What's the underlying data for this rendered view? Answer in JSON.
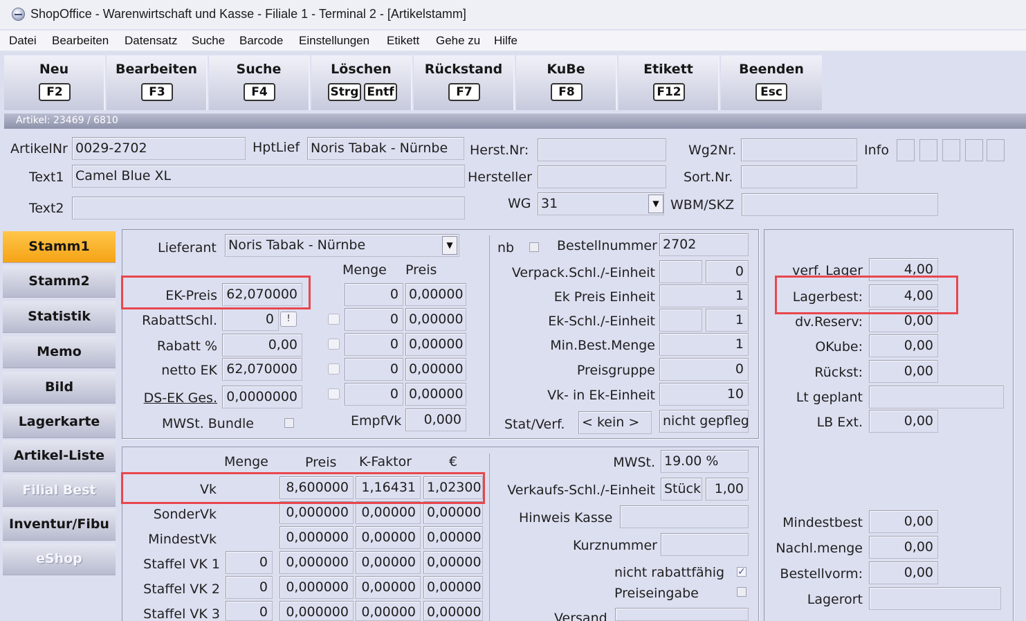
{
  "window": {
    "title": "ShopOffice - Warenwirtschaft und Kasse - Filiale 1 - Terminal 2 - [Artikelstamm]"
  },
  "menu": [
    "Datei",
    "Bearbeiten",
    "Datensatz",
    "Suche",
    "Barcode",
    "Einstellungen",
    "Etikett",
    "Gehe zu",
    "Hilfe"
  ],
  "toolbar": [
    {
      "label": "Neu",
      "keys": [
        "F2"
      ]
    },
    {
      "label": "Bearbeiten",
      "keys": [
        "F3"
      ]
    },
    {
      "label": "Suche",
      "keys": [
        "F4"
      ]
    },
    {
      "label": "Löschen",
      "keys": [
        "Strg",
        "Entf"
      ]
    },
    {
      "label": "Rückstand",
      "keys": [
        "F7"
      ]
    },
    {
      "label": "KuBe",
      "keys": [
        "F8"
      ]
    },
    {
      "label": "Etikett",
      "keys": [
        "F12"
      ]
    },
    {
      "label": "Beenden",
      "keys": [
        "Esc"
      ]
    }
  ],
  "infobar": "Artikel: 23469 / 6810",
  "header": {
    "artikelnr_label": "ArtikelNr",
    "artikelnr": "0029-2702",
    "hptlief_label": "HptLief",
    "hptlief": "Noris Tabak - Nürnbe",
    "herstnr_label": "Herst.Nr:",
    "herstnr": "",
    "wg2nr_label": "Wg2Nr.",
    "wg2nr": "",
    "info_label": "Info",
    "text1_label": "Text1",
    "text1": "Camel Blue XL",
    "hersteller_label": "Hersteller",
    "hersteller": "",
    "sortnr_label": "Sort.Nr.",
    "sortnr": "",
    "text2_label": "Text2",
    "text2": "",
    "wg_label": "WG",
    "wg": "31",
    "wbm_label": "WBM/SKZ",
    "wbm": ""
  },
  "sidebar": [
    {
      "label": "Stamm1",
      "state": "active"
    },
    {
      "label": "Stamm2",
      "state": "normal"
    },
    {
      "label": "Statistik",
      "state": "normal"
    },
    {
      "label": "Memo",
      "state": "normal"
    },
    {
      "label": "Bild",
      "state": "normal"
    },
    {
      "label": "Lagerkarte",
      "state": "normal"
    },
    {
      "label": "Artikel-Liste",
      "state": "normal"
    },
    {
      "label": "Filial Best",
      "state": "disabled"
    },
    {
      "label": "Inventur/Fibu",
      "state": "normal"
    },
    {
      "label": "eShop",
      "state": "disabled"
    }
  ],
  "purchase": {
    "lieferant_label": "Lieferant",
    "lieferant": "Noris Tabak - Nürnbe",
    "menge_header": "Menge",
    "preis_header": "Preis",
    "ekpreis_label": "EK-Preis",
    "ekpreis": "62,070000",
    "rabattschl_label": "RabattSchl.",
    "rabattschl": "0",
    "rabattschl_btn": "!",
    "rabatt_label": "Rabatt %",
    "rabatt": "0,00",
    "nettoek_label": "netto EK",
    "nettoek": "62,070000",
    "dsek_label": "DS-EK Ges.",
    "dsek": "0,0000000",
    "mwst_bundle_label": "MWSt. Bundle",
    "staffel_rows": [
      {
        "menge": "0",
        "preis": "0,00000"
      },
      {
        "menge": "0",
        "preis": "0,00000"
      },
      {
        "menge": "0",
        "preis": "0,00000"
      },
      {
        "menge": "0",
        "preis": "0,00000"
      },
      {
        "menge": "0",
        "preis": "0,00000"
      }
    ],
    "empfvk_label": "EmpfVk",
    "empfvk": "0,000"
  },
  "order": {
    "nb_label": "nb",
    "bestellnummer_label": "Bestellnummer",
    "bestellnummer": "2702",
    "verpack_label": "Verpack.Schl./-Einheit",
    "verpack_a": "",
    "verpack_b": "0",
    "ekpreiseinheit_label": "Ek Preis Einheit",
    "ekpreiseinheit": "1",
    "ekschl_label": "Ek-Schl./-Einheit",
    "ekschl_a": "",
    "ekschl_b": "1",
    "minbest_label": "Min.Best.Menge",
    "minbest": "1",
    "preisgruppe_label": "Preisgruppe",
    "preisgruppe": "0",
    "vkinek_label": "Vk-  in Ek-Einheit",
    "vkinek": "10",
    "statverf_label": "Stat/Verf.",
    "statverf_a": "< kein  >",
    "statverf_b": "nicht gepfleg"
  },
  "stock": {
    "verflager_label": "verf. Lager",
    "verflager": "4,00",
    "lagerbest_label": "Lagerbest:",
    "lagerbest": "4,00",
    "dvreserv_label": "dv.Reserv:",
    "dvreserv": "0,00",
    "okube_label": "OKube:",
    "okube": "0,00",
    "rueckst_label": "Rückst:",
    "rueckst": "0,00",
    "ltgeplant_label": "Lt geplant",
    "ltgeplant": "",
    "lbext_label": "LB Ext.",
    "lbext": "0,00",
    "mindestbest_label": "Mindestbest",
    "mindestbest": "0,00",
    "nachlmenge_label": "Nachl.menge",
    "nachlmenge": "0,00",
    "bestellvorm_label": "Bestellvorm:",
    "bestellvorm": "0,00",
    "lagerort_label": "Lagerort",
    "lagerort": ""
  },
  "sales": {
    "headers": {
      "menge": "Menge",
      "preis": "Preis",
      "kfaktor": "K-Faktor",
      "euro": "€"
    },
    "vk": {
      "label": "Vk",
      "preis": "8,600000",
      "kfaktor": "1,16431",
      "euro": "1,02300"
    },
    "sondervk": {
      "label": "SonderVk",
      "preis": "0,000000",
      "kfaktor": "0,00000",
      "euro": "0,00000"
    },
    "mindestvk": {
      "label": "MindestVk",
      "preis": "0,000000",
      "kfaktor": "0,00000",
      "euro": "0,00000"
    },
    "staffel": [
      {
        "label": "Staffel VK 1",
        "menge": "0",
        "preis": "0,000000",
        "kfaktor": "0,00000",
        "euro": "0,00000"
      },
      {
        "label": "Staffel VK 2",
        "menge": "0",
        "preis": "0,000000",
        "kfaktor": "0,00000",
        "euro": "0,00000"
      },
      {
        "label": "Staffel VK 3",
        "menge": "0",
        "preis": "0,000000",
        "kfaktor": "0,00000",
        "euro": "0,00000"
      }
    ]
  },
  "salesright": {
    "mwst_label": "MWSt.",
    "mwst": "19.00 %",
    "vkschl_label": "Verkaufs-Schl./-Einheit",
    "vkschl_a": "Stück",
    "vkschl_b": "1,00",
    "hinweis_label": "Hinweis Kasse",
    "hinweis": "",
    "kurznummer_label": "Kurznummer",
    "kurznummer": "",
    "nichtrabatt_label": "nicht rabattfähig",
    "preiseingabe_label": "Preiseingabe",
    "versand_label": "Versand"
  }
}
